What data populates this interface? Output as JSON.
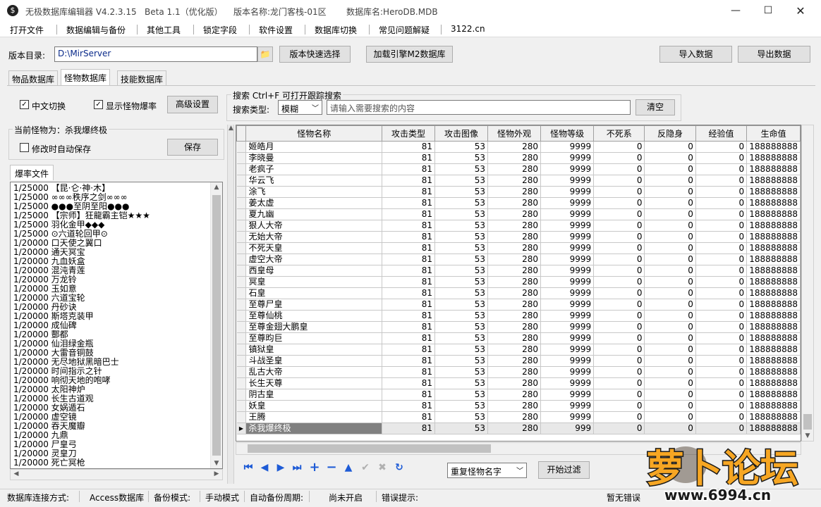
{
  "title": {
    "app": "无极数据库编辑器 V4.2.3.15",
    "beta": "Beta 1.1（优化版）",
    "version_name": "版本名称:龙门客栈-01区",
    "db_name": "数据库名:HeroDB.MDB"
  },
  "menu": [
    "打开文件",
    "数据编辑与备份",
    "其他工具",
    "锁定字段",
    "软件设置",
    "数据库切换",
    "常见问题解疑",
    "3122.cn"
  ],
  "toolbar": {
    "version_dir_label": "版本目录:",
    "version_dir_value": "D:\\MirServer",
    "quick_select": "版本快速选择",
    "load_engine": "加载引擎M2数据库",
    "import": "导入数据",
    "export": "导出数据"
  },
  "tabs": [
    "物品数据库",
    "怪物数据库",
    "技能数据库"
  ],
  "options": {
    "cn_switch": "中文切换",
    "show_rate": "显示怪物爆率",
    "advanced": "高级设置"
  },
  "search": {
    "title": "搜索   Ctrl+F 可打开跟踪搜索",
    "type_label": "搜索类型:",
    "type_value": "模糊",
    "placeholder": "请输入需要搜索的内容",
    "clear": "清空"
  },
  "current": {
    "label": "当前怪物为：杀我爆终极",
    "autosave": "修改时自动保存",
    "save": "保存"
  },
  "drop_tab": "爆率文件",
  "drops": [
    "1/25000 【昆·仑·神·木】",
    "1/25000 ∞∞∞秩序之剑∞∞∞",
    "1/25000 ●●●至阴至阳●●●",
    "1/25000 【宗师】狂龍霸主铠★★★",
    "1/25000 羽化金甲◆◆◆",
    "1/25000 ⊙六道轮回甲⊙",
    "1/20000 口天使之翼口",
    "1/20000 通天冥宝",
    "1/20000 九血妖盒",
    "1/20000 混沌青莲",
    "1/20000 万龙铃",
    "1/20000 玉如意",
    "1/20000 六道宝轮",
    "1/20000 丹砂诀",
    "1/20000 斯塔克装甲",
    "1/20000 成仙碑",
    "1/20000 酆都",
    "1/20000 仙泪绿金瓶",
    "1/20000 大雷音铜鼓",
    "1/20000 无尽地狱黑暗巴士",
    "1/20000 时间指示之针",
    "1/20000 响彻天地的咆哮",
    "1/20000 太阳神炉",
    "1/20000 长生古道观",
    "1/20000 女娲遁石",
    "1/20000 虚空镜",
    "1/20000 吞天魔瓣",
    "1/20000 九鼎",
    "1/20000 尸皇弓",
    "1/20000 灵皇刀",
    "1/20000 死亡冥枪"
  ],
  "table": {
    "columns": [
      "怪物名称",
      "攻击类型",
      "攻击图像",
      "怪物外观",
      "怪物等级",
      "不死系",
      "反隐身",
      "经验值",
      "生命值"
    ],
    "rows": [
      [
        "姬皓月",
        "81",
        "53",
        "280",
        "9999",
        "0",
        "0",
        "0",
        "188888888"
      ],
      [
        "李晓曼",
        "81",
        "53",
        "280",
        "9999",
        "0",
        "0",
        "0",
        "188888888"
      ],
      [
        "老疯子",
        "81",
        "53",
        "280",
        "9999",
        "0",
        "0",
        "0",
        "188888888"
      ],
      [
        "华云飞",
        "81",
        "53",
        "280",
        "9999",
        "0",
        "0",
        "0",
        "188888888"
      ],
      [
        "涂飞",
        "81",
        "53",
        "280",
        "9999",
        "0",
        "0",
        "0",
        "188888888"
      ],
      [
        "姜太虚",
        "81",
        "53",
        "280",
        "9999",
        "0",
        "0",
        "0",
        "188888888"
      ],
      [
        "夏九幽",
        "81",
        "53",
        "280",
        "9999",
        "0",
        "0",
        "0",
        "188888888"
      ],
      [
        "狠人大帝",
        "81",
        "53",
        "280",
        "9999",
        "0",
        "0",
        "0",
        "188888888"
      ],
      [
        "无始大帝",
        "81",
        "53",
        "280",
        "9999",
        "0",
        "0",
        "0",
        "188888888"
      ],
      [
        "不死天皇",
        "81",
        "53",
        "280",
        "9999",
        "0",
        "0",
        "0",
        "188888888"
      ],
      [
        "虚空大帝",
        "81",
        "53",
        "280",
        "9999",
        "0",
        "0",
        "0",
        "188888888"
      ],
      [
        "西皇母",
        "81",
        "53",
        "280",
        "9999",
        "0",
        "0",
        "0",
        "188888888"
      ],
      [
        "冥皇",
        "81",
        "53",
        "280",
        "9999",
        "0",
        "0",
        "0",
        "188888888"
      ],
      [
        "石皇",
        "81",
        "53",
        "280",
        "9999",
        "0",
        "0",
        "0",
        "188888888"
      ],
      [
        "至尊尸皇",
        "81",
        "53",
        "280",
        "9999",
        "0",
        "0",
        "0",
        "188888888"
      ],
      [
        "至尊仙桃",
        "81",
        "53",
        "280",
        "9999",
        "0",
        "0",
        "0",
        "188888888"
      ],
      [
        "至尊金翅大鹏皇",
        "81",
        "53",
        "280",
        "9999",
        "0",
        "0",
        "0",
        "188888888"
      ],
      [
        "至尊昀巨",
        "81",
        "53",
        "280",
        "9999",
        "0",
        "0",
        "0",
        "188888888"
      ],
      [
        "镇狱皇",
        "81",
        "53",
        "280",
        "9999",
        "0",
        "0",
        "0",
        "188888888"
      ],
      [
        "斗战圣皇",
        "81",
        "53",
        "280",
        "9999",
        "0",
        "0",
        "0",
        "188888888"
      ],
      [
        "乱古大帝",
        "81",
        "53",
        "280",
        "9999",
        "0",
        "0",
        "0",
        "188888888"
      ],
      [
        "长生天尊",
        "81",
        "53",
        "280",
        "9999",
        "0",
        "0",
        "0",
        "188888888"
      ],
      [
        "阴古皇",
        "81",
        "53",
        "280",
        "9999",
        "0",
        "0",
        "0",
        "188888888"
      ],
      [
        "妖皇",
        "81",
        "53",
        "280",
        "9999",
        "0",
        "0",
        "0",
        "188888888"
      ],
      [
        "王腾",
        "81",
        "53",
        "280",
        "9999",
        "0",
        "0",
        "0",
        "188888888"
      ],
      [
        "杀我爆终极",
        "81",
        "53",
        "280",
        "999",
        "0",
        "0",
        "0",
        "188888888"
      ]
    ]
  },
  "bottom": {
    "filter_value": "重复怪物名字",
    "start_filter": "开始过滤"
  },
  "status": {
    "conn_label": "数据库连接方式:",
    "conn_value": "Access数据库",
    "backup_label": "备份模式:",
    "backup_value": "手动模式",
    "auto_label": "自动备份周期:",
    "auto_value": "尚未开启",
    "error_label": "错误提示:",
    "error_value": "暂无错误"
  },
  "watermark": {
    "text": "萝卜论坛",
    "site": "www.6994.cn"
  },
  "colors": {
    "nav_blue": "#1e5bd6",
    "selection": "#808080",
    "watermark_fill": "#f6a623"
  }
}
